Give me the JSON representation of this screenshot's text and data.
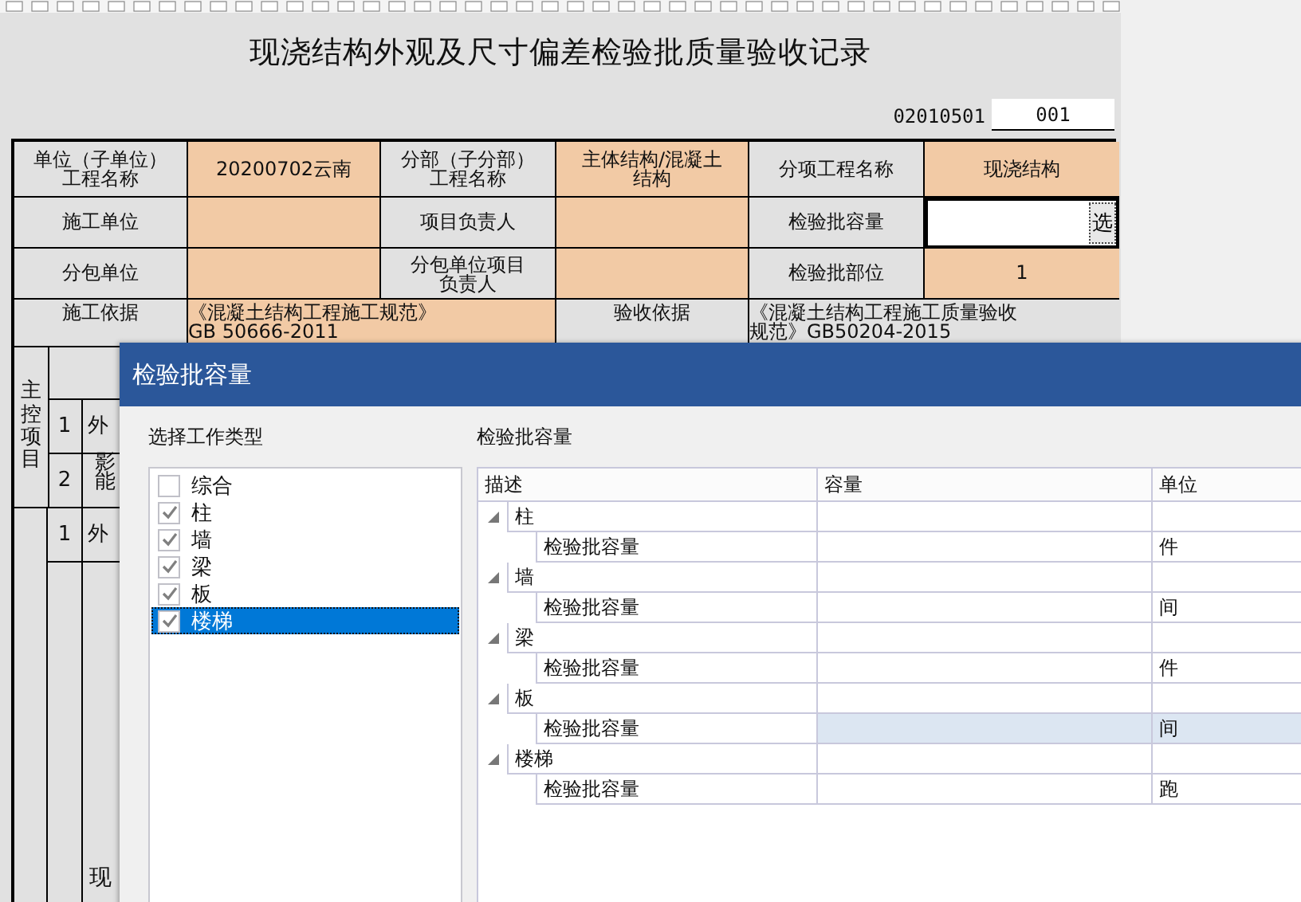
{
  "sheet": {
    "title": "现浇结构外观及尺寸偏差检验批质量验收记录",
    "code": "02010501",
    "serial": "001",
    "form_rows": [
      [
        {
          "kind": "label",
          "lines": [
            "单位（子单位）",
            "工程名称"
          ]
        },
        {
          "kind": "value",
          "text": "20200702云南"
        },
        {
          "kind": "label",
          "lines": [
            "分部（子分部）",
            "工程名称"
          ]
        },
        {
          "kind": "value",
          "lines": [
            "主体结构/混凝土",
            "结构"
          ]
        },
        {
          "kind": "label",
          "text": "分项工程名称"
        },
        {
          "kind": "value",
          "text": "现浇结构"
        }
      ],
      [
        {
          "kind": "label",
          "text": "施工单位"
        },
        {
          "kind": "value"
        },
        {
          "kind": "label",
          "text": "项目负责人"
        },
        {
          "kind": "value"
        },
        {
          "kind": "label",
          "text": "检验批容量"
        },
        {
          "kind": "input",
          "button": "选"
        }
      ],
      [
        {
          "kind": "label",
          "text": "分包单位"
        },
        {
          "kind": "value"
        },
        {
          "kind": "label",
          "lines": [
            "分包单位项目",
            "负责人"
          ]
        },
        {
          "kind": "value"
        },
        {
          "kind": "label",
          "text": "检验批部位"
        },
        {
          "kind": "value",
          "text": "1"
        }
      ],
      [
        {
          "kind": "label",
          "text": "施工依据"
        },
        {
          "kind": "value",
          "lines": [
            "《混凝土结构工程施工规范》",
            "GB 50666-2011"
          ]
        },
        {
          "kind": "label",
          "text": "验收依据"
        },
        {
          "kind": "label",
          "lines": [
            "《混凝土结构工程施工质量验收",
            "规范》GB50204-2015"
          ]
        }
      ]
    ],
    "main_control": {
      "label": "主控项目",
      "items": [
        {
          "number": "1",
          "text": "外"
        },
        {
          "number": "2",
          "lines": [
            "影",
            "能"
          ]
        }
      ]
    },
    "general": {
      "items": [
        {
          "number": "1",
          "text": "外"
        }
      ],
      "sub_label": "现"
    }
  },
  "dialog": {
    "title": "检验批容量",
    "work_types": {
      "label": "选择工作类型",
      "items": [
        {
          "label": "综合",
          "checked": false,
          "selected": false
        },
        {
          "label": "柱",
          "checked": true,
          "selected": false
        },
        {
          "label": "墙",
          "checked": true,
          "selected": false
        },
        {
          "label": "梁",
          "checked": true,
          "selected": false
        },
        {
          "label": "板",
          "checked": true,
          "selected": false
        },
        {
          "label": "楼梯",
          "checked": true,
          "selected": true
        }
      ]
    },
    "capacity": {
      "label": "检验批容量",
      "columns": [
        "描述",
        "容量",
        "单位"
      ],
      "groups": [
        {
          "name": "柱",
          "expanded": true,
          "children": [
            {
              "description": "检验批容量",
              "unit": "件",
              "selected": false
            }
          ]
        },
        {
          "name": "墙",
          "expanded": true,
          "children": [
            {
              "description": "检验批容量",
              "unit": "间",
              "selected": false
            }
          ]
        },
        {
          "name": "梁",
          "expanded": true,
          "children": [
            {
              "description": "检验批容量",
              "unit": "件",
              "selected": false
            }
          ]
        },
        {
          "name": "板",
          "expanded": true,
          "children": [
            {
              "description": "检验批容量",
              "unit": "间",
              "selected": true
            }
          ]
        },
        {
          "name": "楼梯",
          "expanded": true,
          "children": [
            {
              "description": "检验批容量",
              "unit": "跑",
              "selected": false
            }
          ]
        }
      ]
    }
  }
}
